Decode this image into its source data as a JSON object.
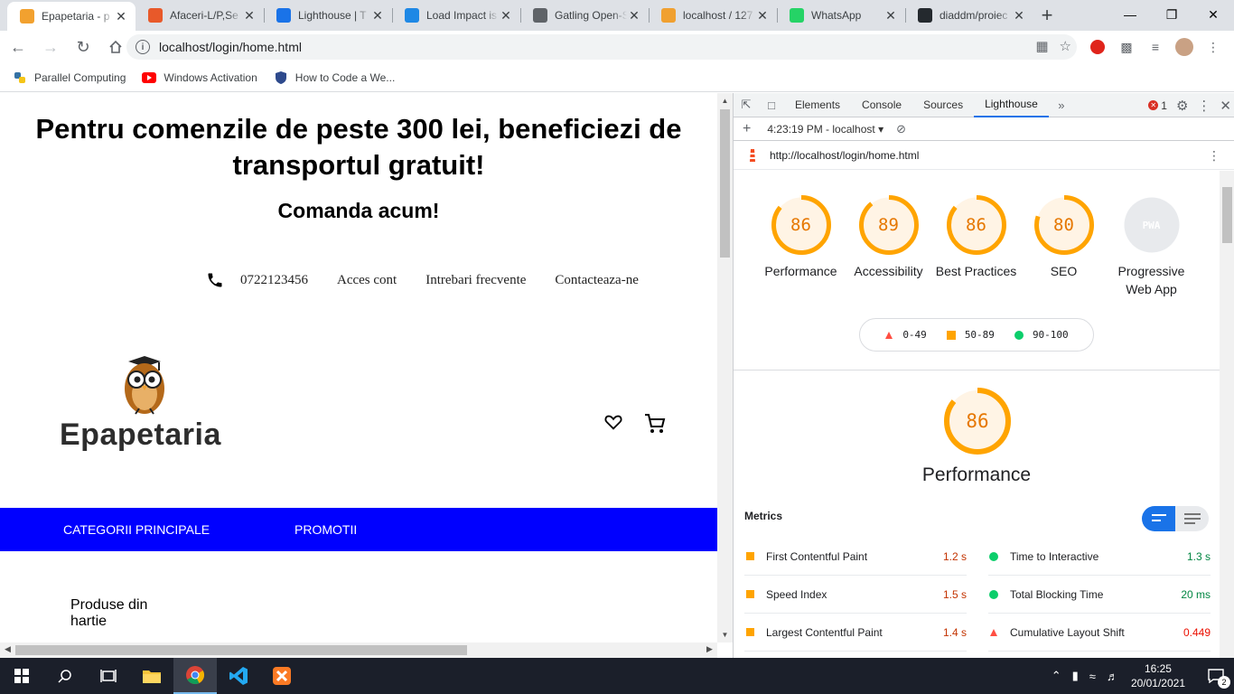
{
  "browser": {
    "tabs": [
      {
        "title": "Epapetaria - p",
        "favicon_color": "#f2a12f",
        "active": true
      },
      {
        "title": "Afaceri-L/P,Se",
        "favicon_color": "#e8592a",
        "active": false
      },
      {
        "title": "Lighthouse | T",
        "favicon_color": "#1a73e8",
        "active": false
      },
      {
        "title": "Load Impact is",
        "favicon_color": "#1e88e5",
        "active": false
      },
      {
        "title": "Gatling Open-S",
        "favicon_color": "#5f6368",
        "active": false
      },
      {
        "title": "localhost / 127",
        "favicon_color": "#f0a030",
        "active": false
      },
      {
        "title": "WhatsApp",
        "favicon_color": "#25d366",
        "active": false
      },
      {
        "title": "diaddm/proiec",
        "favicon_color": "#24292e",
        "active": false
      }
    ],
    "url": "localhost/login/home.html",
    "bookmarks": [
      {
        "label": "Parallel Computing",
        "icon": "python-icon"
      },
      {
        "label": "Windows Activation",
        "icon": "youtube-icon"
      },
      {
        "label": "How to Code a We...",
        "icon": "shield-icon"
      }
    ]
  },
  "site": {
    "promo_title": "Pentru comenzile de peste 300 lei, beneficiezi de transportul gratuit!",
    "promo_subtitle": "Comanda acum!",
    "phone": "0722123456",
    "nav": [
      "Acces cont",
      "Intrebari frecvente",
      "Contacteaza-ne"
    ],
    "logo_text": "Epapetaria",
    "categories": [
      "CATEGORII PRINCIPALE",
      "PROMOTII"
    ],
    "side_category": "Produse din hartie",
    "category_bar_color": "#0000ff"
  },
  "devtools": {
    "tabs": [
      "Elements",
      "Console",
      "Sources",
      "Lighthouse"
    ],
    "active_tab": "Lighthouse",
    "error_count": "1",
    "report_selector": "4:23:19 PM - localhost",
    "report_url": "http://localhost/login/home.html",
    "gauges": [
      {
        "score": "86",
        "label": "Performance",
        "fraction": 0.86
      },
      {
        "score": "89",
        "label": "Accessibility",
        "fraction": 0.89
      },
      {
        "score": "86",
        "label": "Best Practices",
        "fraction": 0.86
      },
      {
        "score": "80",
        "label": "SEO",
        "fraction": 0.8
      },
      {
        "score": "PWA",
        "label": "Progressive Web App",
        "fraction": 0
      }
    ],
    "legend": [
      {
        "range": "0-49",
        "color": "#ff4e42",
        "shape": "triangle"
      },
      {
        "range": "50-89",
        "color": "#ffa400",
        "shape": "square"
      },
      {
        "range": "90-100",
        "color": "#0cce6b",
        "shape": "circle"
      }
    ],
    "performance_score": "86",
    "performance_fraction": 0.86,
    "performance_title": "Performance",
    "metrics_heading": "Metrics",
    "metrics": [
      {
        "name": "First Contentful Paint",
        "value": "1.2 s",
        "status": "average"
      },
      {
        "name": "Time to Interactive",
        "value": "1.3 s",
        "status": "pass"
      },
      {
        "name": "Speed Index",
        "value": "1.5 s",
        "status": "average"
      },
      {
        "name": "Total Blocking Time",
        "value": "20 ms",
        "status": "pass"
      },
      {
        "name": "Largest Contentful Paint",
        "value": "1.4 s",
        "status": "average"
      },
      {
        "name": "Cumulative Layout Shift",
        "value": "0.449",
        "status": "fail"
      }
    ],
    "colors": {
      "pass": "#0cce6b",
      "average": "#ffa400",
      "fail": "#ff4e42",
      "pass_text": "#018642",
      "average_text": "#c33300",
      "fail_text": "#eb0f00"
    }
  },
  "taskbar": {
    "time": "16:25",
    "date": "20/01/2021",
    "notifications": "2"
  }
}
